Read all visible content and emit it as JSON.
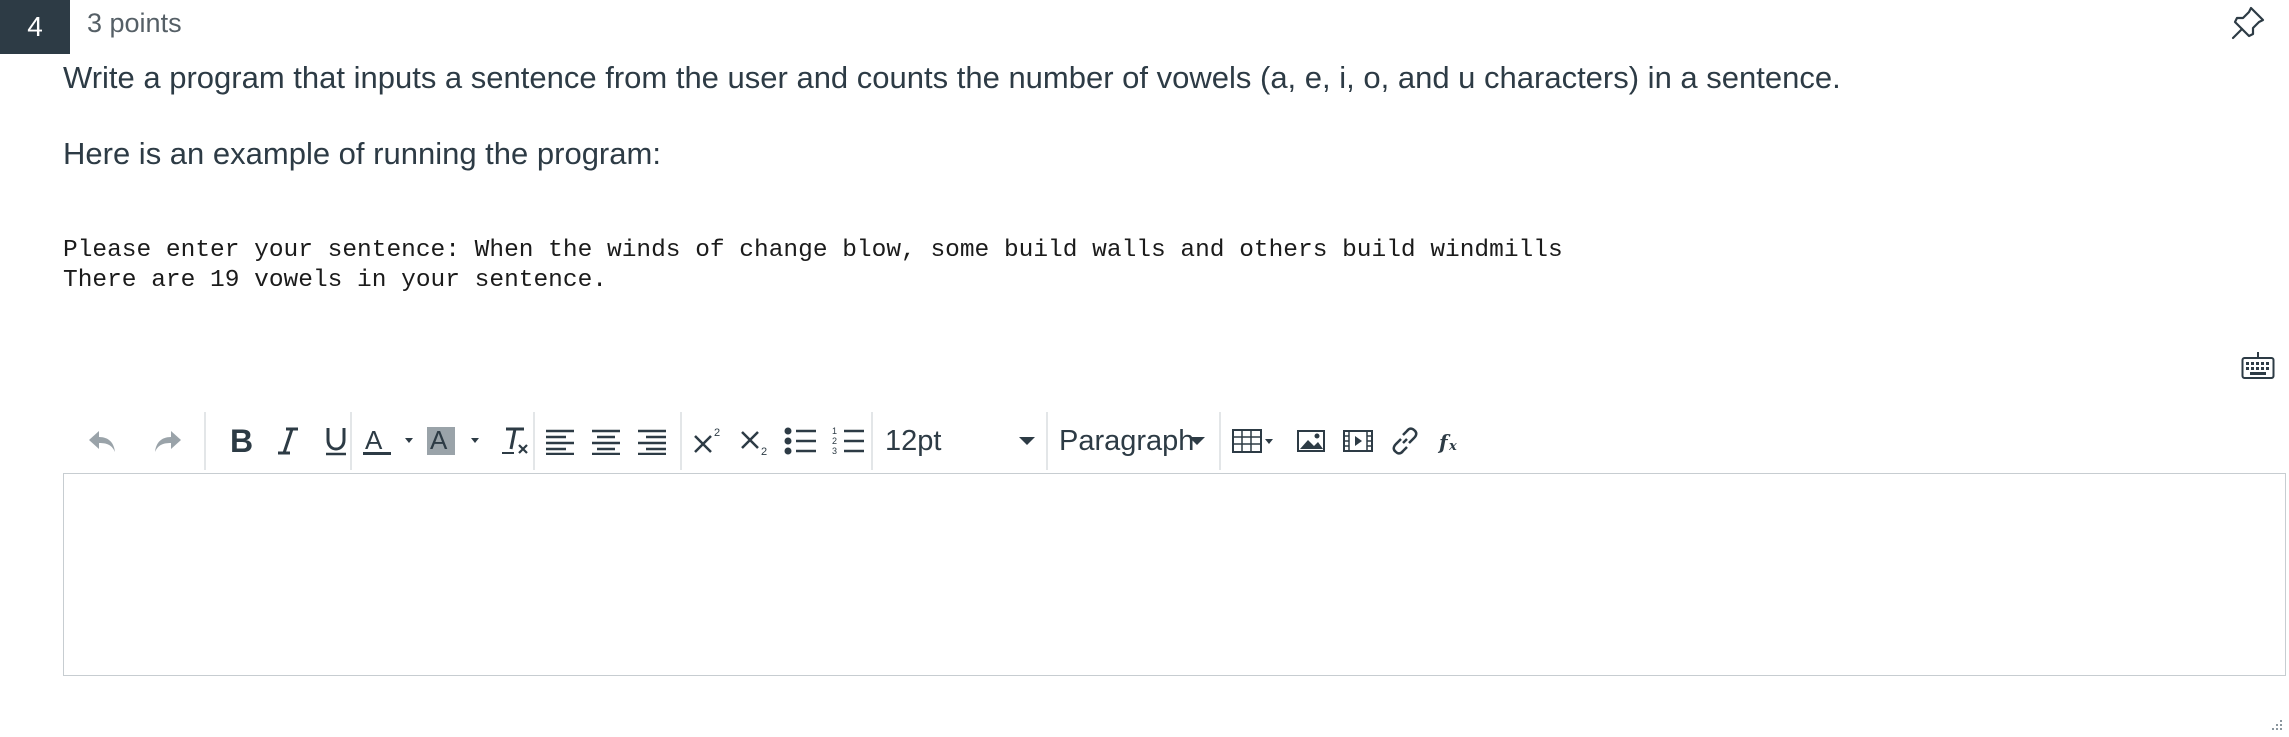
{
  "question": {
    "number": "4",
    "points": "3 points",
    "prompt_line1": "Write a program that inputs a sentence from the user and counts the number of vowels (a, e, i, o, and u characters) in a sentence.",
    "prompt_line2": "Here is an example of running the program:",
    "example_line1": "Please enter your sentence: When the winds of change blow, some build walls and others build windmills",
    "example_line2": "There are 19 vowels in your sentence."
  },
  "toolbar": {
    "font_size": "12pt",
    "block_format": "Paragraph",
    "buttons": [
      "undo",
      "redo",
      "bold",
      "italic",
      "underline",
      "text-color",
      "background-color",
      "clear-formatting",
      "align-left",
      "align-center",
      "align-right",
      "superscript",
      "subscript",
      "bullet-list",
      "numbered-list",
      "table",
      "image",
      "media",
      "link",
      "equation"
    ]
  },
  "editor": {
    "content": ""
  },
  "colors": {
    "number_badge_bg": "#2d3b45",
    "text": "#2d3b45",
    "border": "#c7cdd1"
  }
}
